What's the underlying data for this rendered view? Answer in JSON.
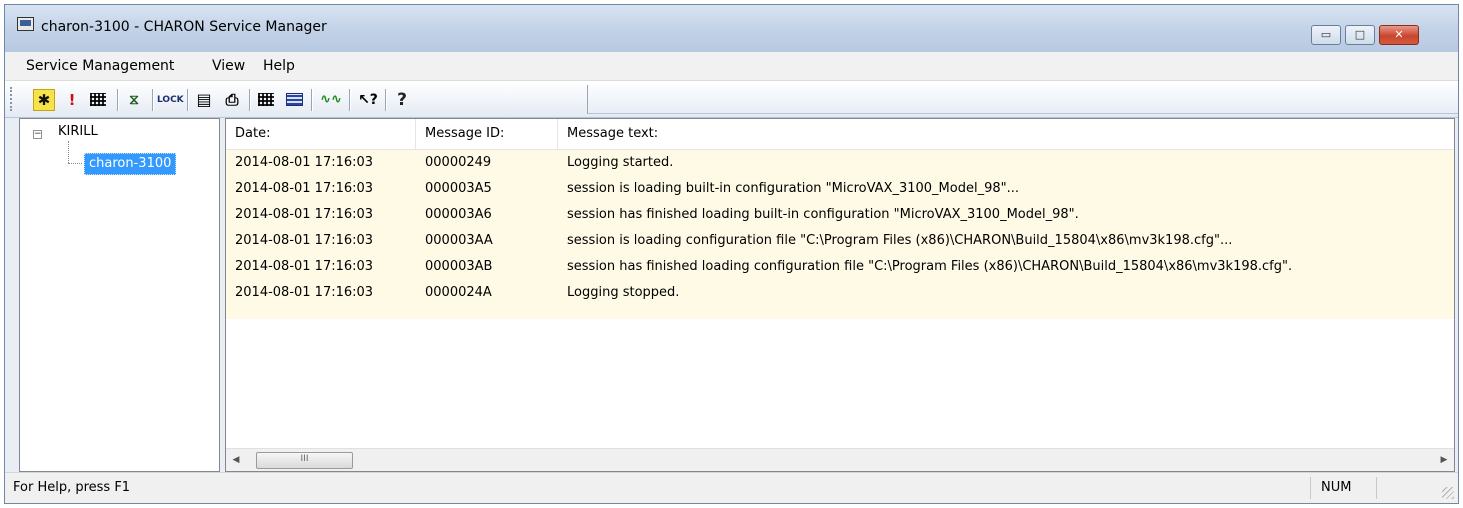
{
  "window": {
    "title": "charon-3100 - CHARON Service Manager",
    "controls": {
      "minimize": "▭",
      "maximize": "□",
      "close": "✕"
    }
  },
  "menu": [
    "Service Management",
    "View",
    "Help"
  ],
  "toolbar": {
    "icons": [
      "tools-icon",
      "exclamation-icon",
      "grid-icon",
      "hourglass-icon",
      "lock-icon",
      "clipboard-icon",
      "printer-icon",
      "table-icon",
      "list-icon",
      "waveform-icon",
      "pointer-help-icon",
      "help-icon"
    ],
    "lock_label": "LOCK"
  },
  "tree": {
    "root": "KIRILL",
    "child": "charon-3100"
  },
  "log": {
    "columns": [
      "Date:",
      "Message ID:",
      "Message text:"
    ],
    "rows": [
      {
        "date": "2014-08-01 17:16:03",
        "id": "00000249",
        "text": "Logging started."
      },
      {
        "date": "2014-08-01 17:16:03",
        "id": "000003A5",
        "text": "session is loading built-in configuration \"MicroVAX_3100_Model_98\"..."
      },
      {
        "date": "2014-08-01 17:16:03",
        "id": "000003A6",
        "text": "session has finished loading built-in configuration \"MicroVAX_3100_Model_98\"."
      },
      {
        "date": "2014-08-01 17:16:03",
        "id": "000003AA",
        "text": "session is loading configuration file \"C:\\Program Files (x86)\\CHARON\\Build_15804\\x86\\mv3k198.cfg\"..."
      },
      {
        "date": "2014-08-01 17:16:03",
        "id": "000003AB",
        "text": "session has finished loading configuration file \"C:\\Program Files (x86)\\CHARON\\Build_15804\\x86\\mv3k198.cfg\"."
      },
      {
        "date": "2014-08-01 17:16:03",
        "id": "0000024A",
        "text": "Logging stopped."
      }
    ],
    "row_background": "#fffae6"
  },
  "scrollbar": {
    "thumb_label": "III",
    "left_arrow": "◀",
    "right_arrow": "▶"
  },
  "status": {
    "text": "For Help, press F1",
    "num": "NUM"
  },
  "colors": {
    "selection": "#3399ff",
    "titlebar": "#c3d3e8",
    "close_button": "#c8462e"
  }
}
